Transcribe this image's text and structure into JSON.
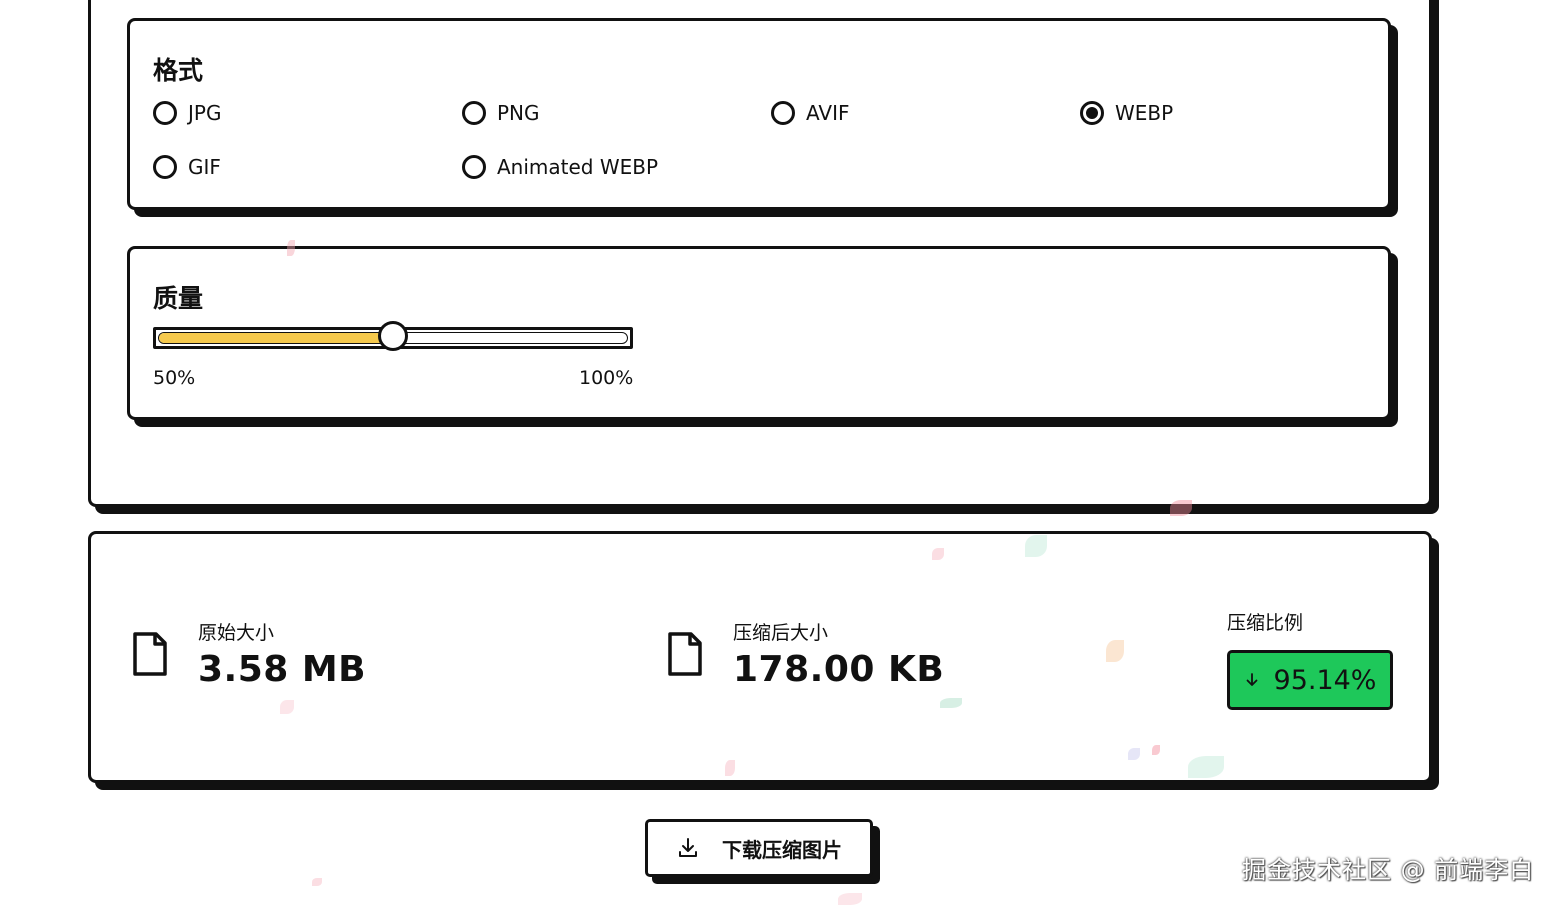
{
  "format": {
    "title": "格式",
    "options": [
      "JPG",
      "PNG",
      "AVIF",
      "WEBP",
      "GIF",
      "Animated WEBP"
    ],
    "selected": "WEBP"
  },
  "quality": {
    "title": "质量",
    "min_label": "50%",
    "max_label": "100%",
    "value_fraction": 0.5
  },
  "result": {
    "original_label": "原始大小",
    "original_value": "3.58 MB",
    "compressed_label": "压缩后大小",
    "compressed_value": "178.00 KB",
    "ratio_label": "压缩比例",
    "ratio_value": "95.14%"
  },
  "download_button": {
    "label": "下载压缩图片"
  },
  "watermark": "掘金技术社区 @ 前端李白",
  "colors": {
    "slider_fill": "#f5c94d",
    "ratio_badge": "#1ec85a",
    "border": "#111111"
  },
  "icons": [
    "file-icon",
    "arrow-down-icon",
    "download-icon"
  ]
}
